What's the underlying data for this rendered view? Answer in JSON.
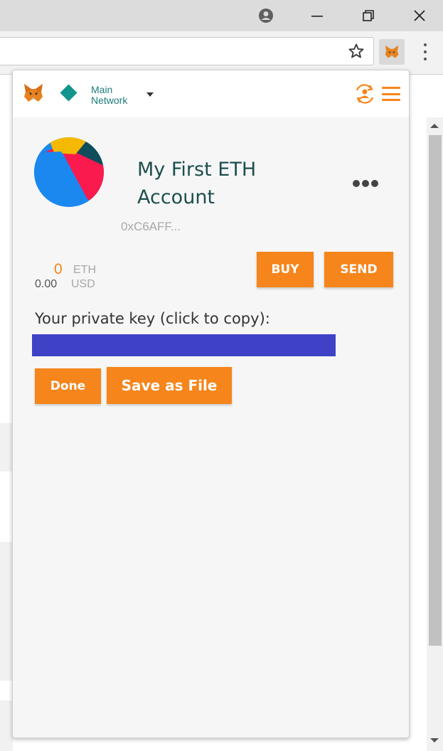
{
  "browser": {
    "window_controls": {
      "profile_icon": "profile-icon",
      "minimize_icon": "minimize-icon",
      "restore_icon": "restore-icon",
      "close_icon": "close-icon"
    },
    "toolbar": {
      "address_value": "",
      "star_icon": "star-icon",
      "extension_icon": "metamask-fox-icon",
      "menu_icon": "kebab-menu-icon"
    }
  },
  "metamask": {
    "network": {
      "line1": "Main",
      "line2": "Network"
    },
    "account": {
      "name": "My First ETH Account",
      "address": "0xC6AFF..."
    },
    "balance": {
      "eth_value": "0",
      "eth_unit": "ETH",
      "usd_value": "0.00",
      "usd_unit": "USD"
    },
    "buttons": {
      "buy": "BUY",
      "send": "SEND",
      "done": "Done",
      "save_as_file": "Save as File"
    },
    "private_key": {
      "label": "Your private key (click to copy):",
      "value": ""
    },
    "colors": {
      "accent_orange": "#f6851b",
      "network_teal": "#10948c",
      "account_name": "#1e4e4e",
      "private_key_highlight": "#3f42c7",
      "identicon": [
        "#1b88f0",
        "#fa1a4d",
        "#f5b900",
        "#0e4d5c"
      ]
    }
  }
}
